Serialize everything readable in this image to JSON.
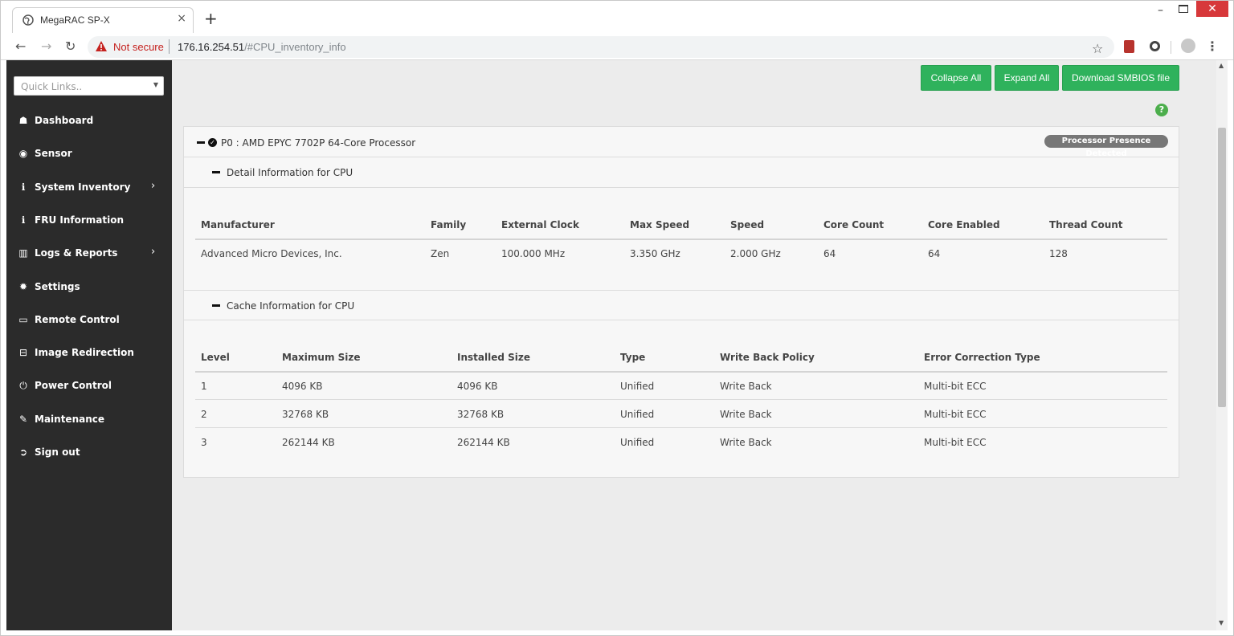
{
  "browser": {
    "tab_title": "MegaRAC SP-X",
    "tab_close": "×",
    "new_tab": "+",
    "security_label": "Not secure",
    "url_host": "176.16.254.51",
    "url_path": "/#CPU_inventory_info",
    "window_controls": {
      "minimize": "–",
      "close": "✕"
    }
  },
  "sidebar": {
    "quick_links_placeholder": "Quick Links..",
    "items": [
      {
        "label": "Dashboard",
        "icon": "dashboard-icon",
        "glyph": "☗",
        "has_submenu": false
      },
      {
        "label": "Sensor",
        "icon": "sensor-icon",
        "glyph": "◉",
        "has_submenu": false
      },
      {
        "label": "System Inventory",
        "icon": "info-icon",
        "glyph": "ℹ",
        "has_submenu": true
      },
      {
        "label": "FRU Information",
        "icon": "info-icon",
        "glyph": "ℹ",
        "has_submenu": false
      },
      {
        "label": "Logs & Reports",
        "icon": "bar-chart-icon",
        "glyph": "▥",
        "has_submenu": true
      },
      {
        "label": "Settings",
        "icon": "gear-icon",
        "glyph": "✹",
        "has_submenu": false
      },
      {
        "label": "Remote Control",
        "icon": "monitor-icon",
        "glyph": "▭",
        "has_submenu": false
      },
      {
        "label": "Image Redirection",
        "icon": "disk-icon",
        "glyph": "⊟",
        "has_submenu": false
      },
      {
        "label": "Power Control",
        "icon": "power-icon",
        "glyph": "⏻",
        "has_submenu": false
      },
      {
        "label": "Maintenance",
        "icon": "wrench-icon",
        "glyph": "✎",
        "has_submenu": false
      },
      {
        "label": "Sign out",
        "icon": "sign-out-icon",
        "glyph": "➲",
        "has_submenu": false
      }
    ]
  },
  "toolbar": {
    "collapse_all": "Collapse All",
    "expand_all": "Expand All",
    "download_smbios": "Download SMBIOS file",
    "help": "?"
  },
  "processor": {
    "title": "P0 : AMD EPYC 7702P 64-Core Processor",
    "presence": "Processor Presence Detected",
    "detail_section": {
      "title": "Detail Information for CPU",
      "headers": [
        "Manufacturer",
        "Family",
        "External Clock",
        "Max Speed",
        "Speed",
        "Core Count",
        "Core Enabled",
        "Thread Count"
      ],
      "row": [
        "Advanced Micro Devices, Inc.",
        "Zen",
        "100.000 MHz",
        "3.350 GHz",
        "2.000 GHz",
        "64",
        "64",
        "128"
      ]
    },
    "cache_section": {
      "title": "Cache Information for CPU",
      "headers": [
        "Level",
        "Maximum Size",
        "Installed Size",
        "Type",
        "Write Back Policy",
        "Error Correction Type"
      ],
      "rows": [
        [
          "1",
          "4096 KB",
          "4096 KB",
          "Unified",
          "Write Back",
          "Multi-bit ECC"
        ],
        [
          "2",
          "32768 KB",
          "32768 KB",
          "Unified",
          "Write Back",
          "Multi-bit ECC"
        ],
        [
          "3",
          "262144 KB",
          "262144 KB",
          "Unified",
          "Write Back",
          "Multi-bit ECC"
        ]
      ]
    }
  },
  "colors": {
    "sidebar_bg": "#2b2b2b",
    "button_green": "#2fb25c",
    "content_bg": "#ececec",
    "warning_red": "#c5221f"
  }
}
